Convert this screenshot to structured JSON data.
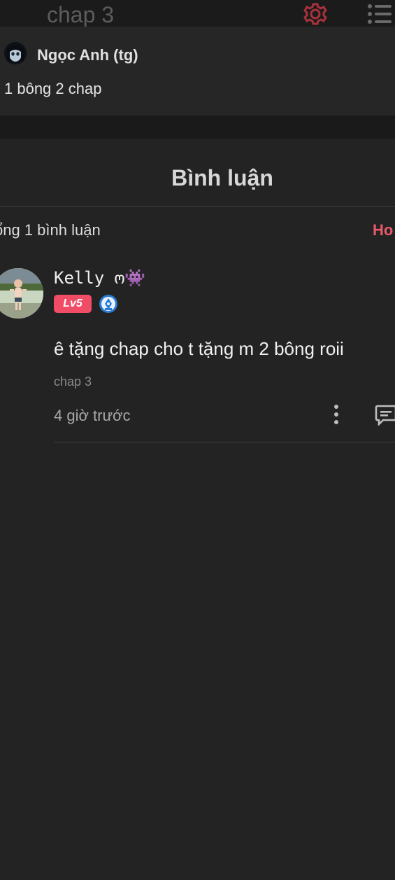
{
  "topbar": {
    "title": "chap 3",
    "gear_icon": "gear-icon",
    "menu_icon": "list-menu-icon",
    "gear_color": "#a8323c"
  },
  "author_note": {
    "author": "Ngọc Anh (tg)",
    "text": "1 bông 2 chap"
  },
  "comments": {
    "title": "Bình luận",
    "total_label": "ổng 1 bình luận",
    "sort_label": "Ho",
    "accent_color": "#e85a6a",
    "items": [
      {
        "username": "Kelly ო👾",
        "level_badge": "Lv5",
        "rank_icon": "pen-nib-badge-icon",
        "text": "ê tặng chap cho t tặng m 2 bông roii",
        "chapter": "chap 3",
        "time": "4 giờ trước",
        "more_icon": "more-vertical-icon",
        "reply_icon": "reply-comment-icon"
      }
    ]
  }
}
